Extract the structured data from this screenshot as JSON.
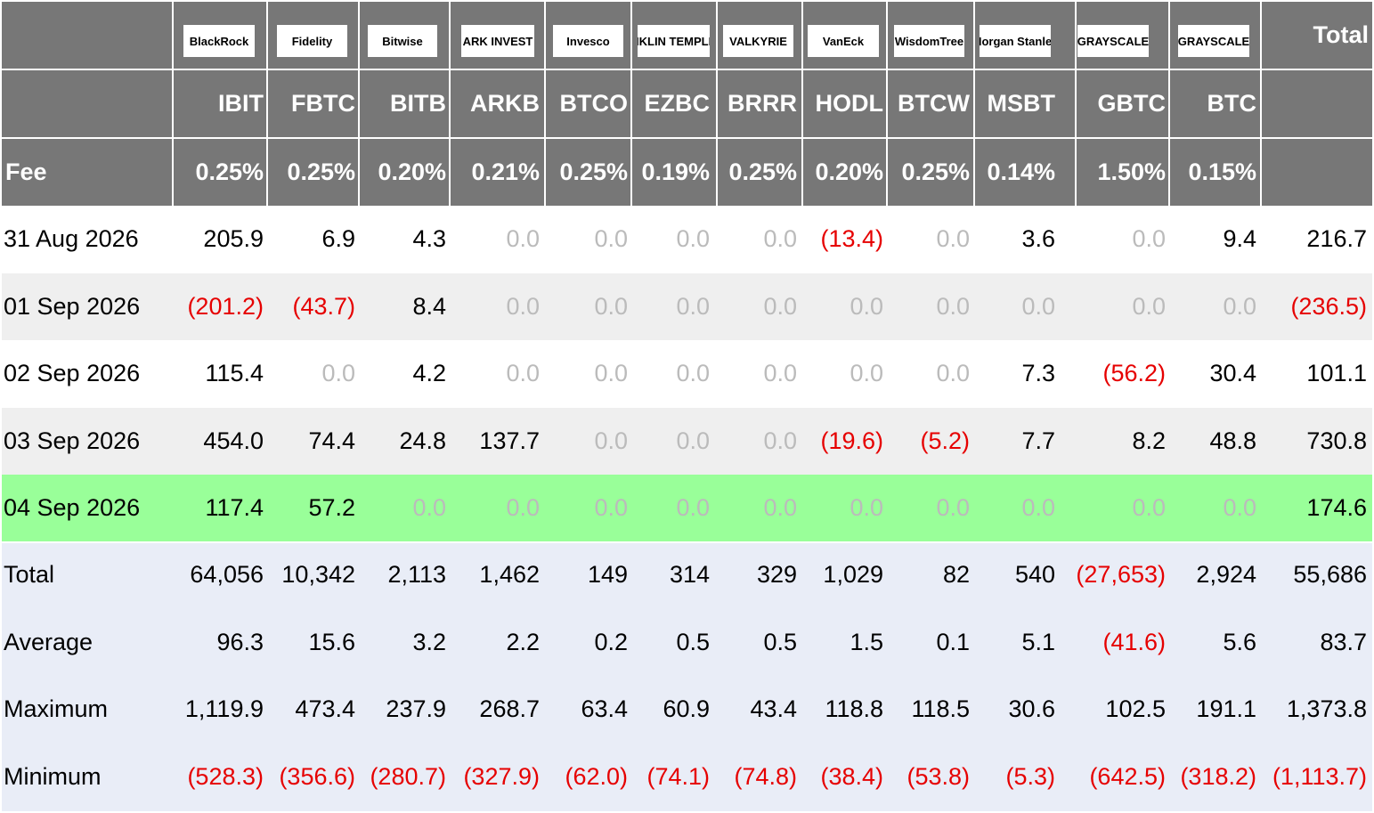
{
  "issuers": [
    {
      "logo": "BlackRock",
      "ticker": "IBIT",
      "fee": "0.25%"
    },
    {
      "logo": "Fidelity",
      "ticker": "FBTC",
      "fee": "0.25%"
    },
    {
      "logo": "Bitwise",
      "ticker": "BITB",
      "fee": "0.20%"
    },
    {
      "logo": "ARK INVEST",
      "ticker": "ARKB",
      "fee": "0.21%"
    },
    {
      "logo": "Invesco",
      "ticker": "BTCO",
      "fee": "0.25%"
    },
    {
      "logo": "FRANKLIN TEMPLETON",
      "ticker": "EZBC",
      "fee": "0.19%"
    },
    {
      "logo": "VALKYRIE",
      "ticker": "BRRR",
      "fee": "0.25%"
    },
    {
      "logo": "VanEck",
      "ticker": "HODL",
      "fee": "0.20%"
    },
    {
      "logo": "WisdomTree",
      "ticker": "BTCW",
      "fee": "0.25%"
    },
    {
      "logo": "Morgan Stanley",
      "ticker": "MSBT",
      "fee": "0.14%"
    },
    {
      "logo": "GRAYSCALE",
      "ticker": "GBTC",
      "fee": "1.50%"
    },
    {
      "logo": "GRAYSCALE",
      "ticker": "BTC",
      "fee": "0.15%"
    }
  ],
  "header": {
    "total_label": "Total",
    "fee_label": "Fee"
  },
  "rows": [
    {
      "label": "31 Aug 2026",
      "values": [
        "205.9",
        "6.9",
        "4.3",
        "0.0",
        "0.0",
        "0.0",
        "0.0",
        "(13.4)",
        "0.0",
        "3.6",
        "0.0",
        "9.4",
        "216.7"
      ]
    },
    {
      "label": "01 Sep 2026",
      "values": [
        "(201.2)",
        "(43.7)",
        "8.4",
        "0.0",
        "0.0",
        "0.0",
        "0.0",
        "0.0",
        "0.0",
        "0.0",
        "0.0",
        "0.0",
        "(236.5)"
      ]
    },
    {
      "label": "02 Sep 2026",
      "values": [
        "115.4",
        "0.0",
        "4.2",
        "0.0",
        "0.0",
        "0.0",
        "0.0",
        "0.0",
        "0.0",
        "7.3",
        "(56.2)",
        "30.4",
        "101.1"
      ]
    },
    {
      "label": "03 Sep 2026",
      "values": [
        "454.0",
        "74.4",
        "24.8",
        "137.7",
        "0.0",
        "0.0",
        "0.0",
        "(19.6)",
        "(5.2)",
        "7.7",
        "8.2",
        "48.8",
        "730.8"
      ]
    },
    {
      "label": "04 Sep 2026",
      "values": [
        "117.4",
        "57.2",
        "0.0",
        "0.0",
        "0.0",
        "0.0",
        "0.0",
        "0.0",
        "0.0",
        "0.0",
        "0.0",
        "0.0",
        "174.6"
      ]
    }
  ],
  "summary": [
    {
      "label": "Total",
      "values": [
        "64,056",
        "10,342",
        "2,113",
        "1,462",
        "149",
        "314",
        "329",
        "1,029",
        "82",
        "540",
        "(27,653)",
        "2,924",
        "55,686"
      ]
    },
    {
      "label": "Average",
      "values": [
        "96.3",
        "15.6",
        "3.2",
        "2.2",
        "0.2",
        "0.5",
        "0.5",
        "1.5",
        "0.1",
        "5.1",
        "(41.6)",
        "5.6",
        "83.7"
      ]
    },
    {
      "label": "Maximum",
      "values": [
        "1,119.9",
        "473.4",
        "237.9",
        "268.7",
        "63.4",
        "60.9",
        "43.4",
        "118.8",
        "118.5",
        "30.6",
        "102.5",
        "191.1",
        "1,373.8"
      ]
    },
    {
      "label": "Minimum",
      "values": [
        "(528.3)",
        "(356.6)",
        "(280.7)",
        "(327.9)",
        "(62.0)",
        "(74.1)",
        "(74.8)",
        "(38.4)",
        "(53.8)",
        "(5.3)",
        "(642.5)",
        "(318.2)",
        "(1,113.7)"
      ]
    }
  ],
  "colors": {
    "header_bg": "#777777",
    "negative": "#e60000",
    "zero": "#bbbbbb",
    "highlight_row": "#99ff99",
    "summary_bg": "#e9edf7",
    "alt_row": "#efefef"
  }
}
